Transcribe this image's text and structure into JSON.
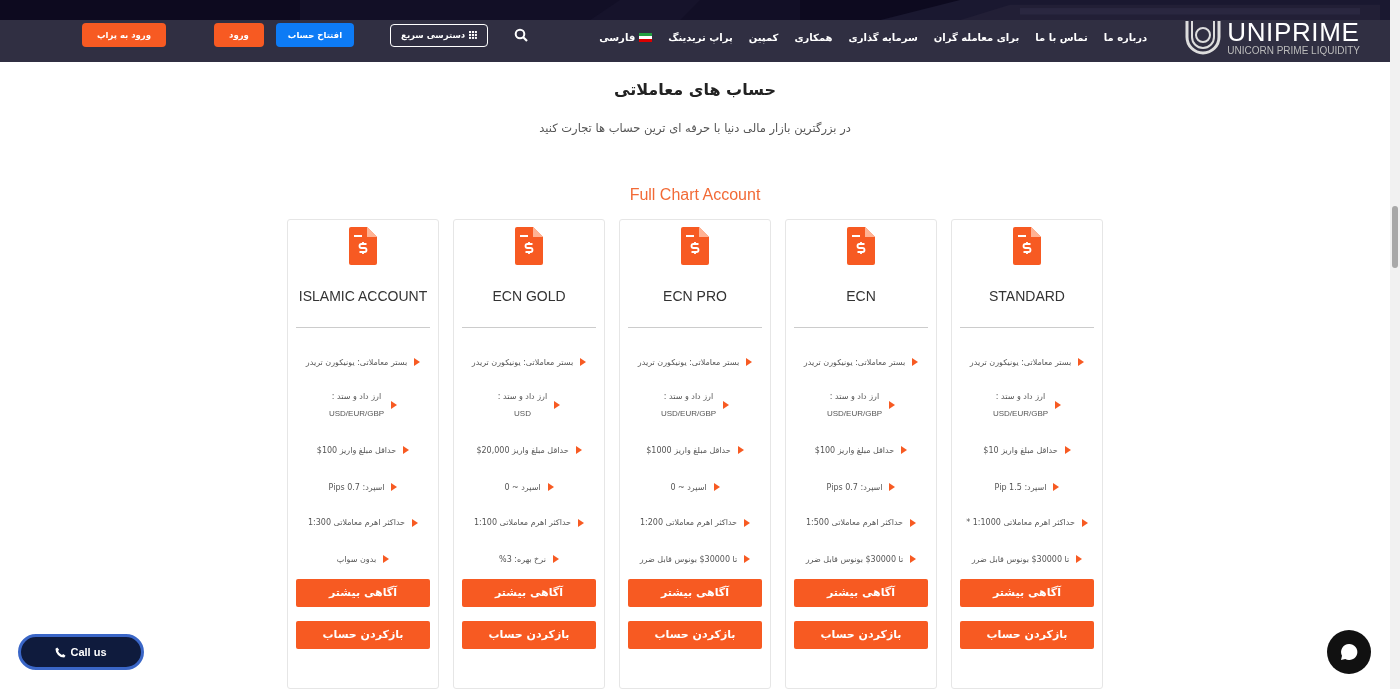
{
  "logo": {
    "name": "UNIPRIME",
    "tagline": "UNICORN PRIME LIQUIDITY"
  },
  "nav": [
    {
      "label": "درباره ما"
    },
    {
      "label": "تماس با ما"
    },
    {
      "label": "برای معامله گران"
    },
    {
      "label": "سرمایه گذاری"
    },
    {
      "label": "همکاری"
    },
    {
      "label": "کمپین"
    },
    {
      "label": "پراپ تریدینگ"
    },
    {
      "label": "فارسی",
      "kind": "language"
    }
  ],
  "header_buttons": [
    {
      "label": "دسترسی سریع",
      "kind": "outline"
    },
    {
      "label": "افتتاح حساب",
      "kind": "blue"
    },
    {
      "label": "ورود",
      "kind": "orange"
    },
    {
      "label": "ورود به پراپ",
      "kind": "orange"
    }
  ],
  "section": {
    "title": "حساب های معاملاتی",
    "subtitle": "در بزرگترین بازار مالی دنیا با حرفه ای ترین حساب ها تجارت کنید",
    "group_title": "Full Chart Account"
  },
  "cards": [
    {
      "title": "STANDARD",
      "features": [
        [
          "بستر معاملاتی: یونیکورن تریدر"
        ],
        [
          "ارز داد و ستد :",
          "USD/EUR/GBP"
        ],
        [
          "حداقل مبلغ واریز 10$"
        ],
        [
          "اسپرد: 1.5 Pip"
        ],
        [
          "حداکثر اهرم معاملاتی 1:1000 *"
        ],
        [
          "تا 30000$ بونوس قابل ضرر"
        ]
      ],
      "buttons": [
        "آگاهی بیشتر",
        "بازکردن حساب"
      ]
    },
    {
      "title": "ECN",
      "features": [
        [
          "بستر معاملاتی: یونیکورن تریدر"
        ],
        [
          "ارز داد و ستد :",
          "USD/EUR/GBP"
        ],
        [
          "حداقل مبلغ واریز 100$"
        ],
        [
          "اسپرد: 0.7 Pips"
        ],
        [
          "حداکثر اهرم معاملاتی 1:500"
        ],
        [
          "تا 30000$ بونوس قابل ضرر"
        ]
      ],
      "buttons": [
        "آگاهی بیشتر",
        "بازکردن حساب"
      ]
    },
    {
      "title": "ECN PRO",
      "features": [
        [
          "بستر معاملاتی: یونیکورن تریدر"
        ],
        [
          "ارز داد و ستد :",
          "USD/EUR/GBP"
        ],
        [
          "حداقل مبلغ واریز 1000$"
        ],
        [
          "اسپرد ~ 0"
        ],
        [
          "حداکثر اهرم معاملاتی 1:200"
        ],
        [
          "تا 30000$ بونوس قابل ضرر"
        ]
      ],
      "buttons": [
        "آگاهی بیشتر",
        "بازکردن حساب"
      ]
    },
    {
      "title": "ECN GOLD",
      "features": [
        [
          "بستر معاملاتی: یونیکورن تریدر"
        ],
        [
          "ارز داد و ستد :",
          "USD"
        ],
        [
          "حداقل مبلغ واریز 20,000$"
        ],
        [
          "اسپرد ~ 0"
        ],
        [
          "حداکثر اهرم معاملاتی 1:100"
        ],
        [
          "نرخ بهره: 3%"
        ]
      ],
      "buttons": [
        "آگاهی بیشتر",
        "بازکردن حساب"
      ]
    },
    {
      "title": "ISLAMIC ACCOUNT",
      "features": [
        [
          "بستر معاملاتی: یونیکورن تریدر"
        ],
        [
          "ارز داد و ستد :",
          "USD/EUR/GBP"
        ],
        [
          "حداقل مبلغ واریز 100$"
        ],
        [
          "اسپرد: 0.7 Pips"
        ],
        [
          "حداکثر اهرم معاملاتی 1:300"
        ],
        [
          "بدون سواپ"
        ]
      ],
      "buttons": [
        "آگاهی بیشتر",
        "بازکردن حساب"
      ]
    }
  ],
  "call_button": {
    "label": "Call us"
  }
}
